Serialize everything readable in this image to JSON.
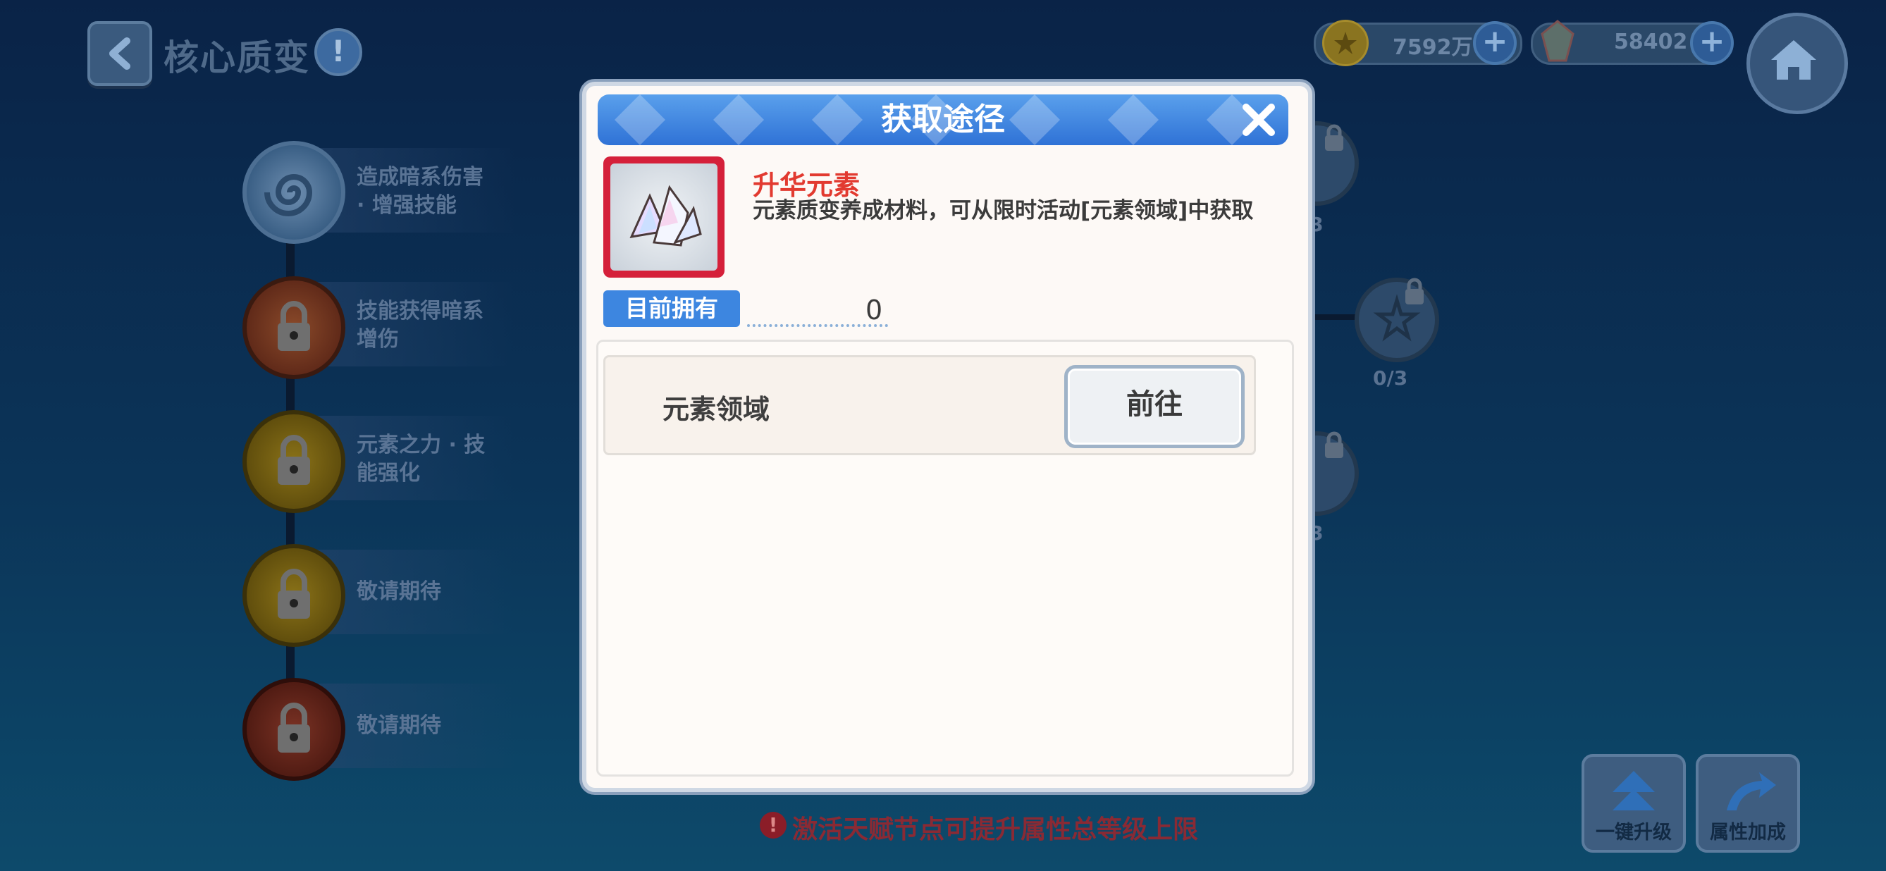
{
  "header": {
    "title": "核心质变",
    "info_icon": "!",
    "gold": "7592万",
    "gems": "58402"
  },
  "talents": [
    {
      "label": "造成暗系伤害 · 增强技能",
      "line1": "造成暗系伤害",
      "line2": "· 增强技能",
      "color": "#3a5f85"
    },
    {
      "label": "技能获得暗系增伤",
      "line1": "技能获得暗系",
      "line2": "增伤",
      "color": "#7a3a1e"
    },
    {
      "label": "元素之力 · 技能强化",
      "line1": "元素之力 · 技",
      "line2": "能强化",
      "color": "#7a6210"
    },
    {
      "label": "敬请期待",
      "line1": "敬请期待",
      "line2": "",
      "color": "#7a6210"
    },
    {
      "label": "敬请期待",
      "line1": "敬请期待",
      "line2": "",
      "color": "#6a2a20"
    }
  ],
  "right_nodes": {
    "count1": "/3",
    "count2": "0/3",
    "count3": "/3"
  },
  "bottom": {
    "tip": "激活天赋节点可提升属性总等级上限",
    "upgrade_all": "一键升级",
    "attr_bonus": "属性加成"
  },
  "modal": {
    "title": "获取途径",
    "item_name": "升华元素",
    "item_desc": "元素质变养成材料，可从限时活动[元素领域]中获取",
    "own_label": "目前拥有",
    "own_count": "0",
    "sources": [
      {
        "name": "元素领域",
        "button": "前往"
      }
    ]
  },
  "colors": {
    "modal_header": "#3f86e2",
    "item_name": "#e23a30",
    "item_frame": "#d5203a"
  }
}
